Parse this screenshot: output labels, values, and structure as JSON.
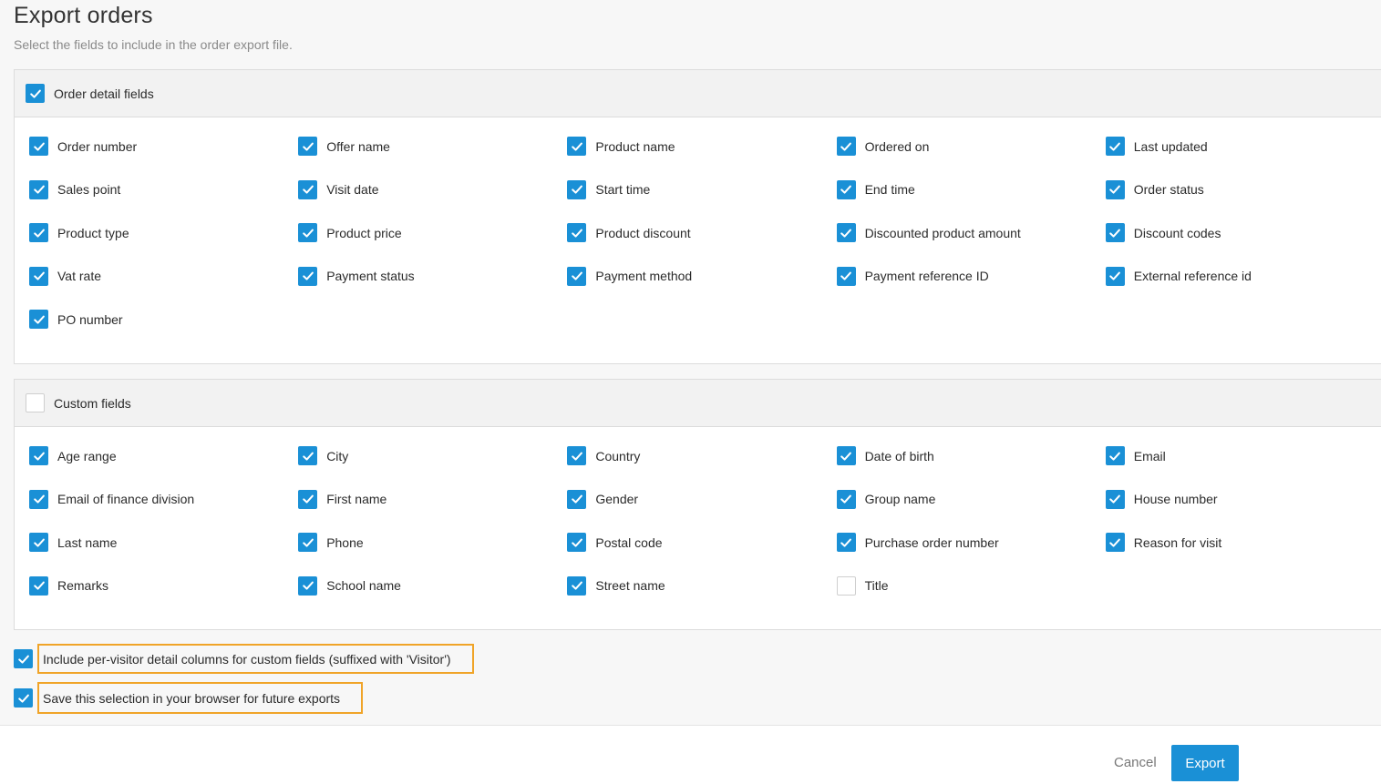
{
  "page": {
    "title": "Export orders",
    "subtitle": "Select the fields to include in the order export file."
  },
  "order_section": {
    "label": "Order detail fields",
    "checked": true,
    "fields": [
      {
        "label": "Order number",
        "checked": true
      },
      {
        "label": "Offer name",
        "checked": true
      },
      {
        "label": "Product name",
        "checked": true
      },
      {
        "label": "Ordered on",
        "checked": true
      },
      {
        "label": "Last updated",
        "checked": true
      },
      {
        "label": "Sales point",
        "checked": true
      },
      {
        "label": "Visit date",
        "checked": true
      },
      {
        "label": "Start time",
        "checked": true
      },
      {
        "label": "End time",
        "checked": true
      },
      {
        "label": "Order status",
        "checked": true
      },
      {
        "label": "Product type",
        "checked": true
      },
      {
        "label": "Product price",
        "checked": true
      },
      {
        "label": "Product discount",
        "checked": true
      },
      {
        "label": "Discounted product amount",
        "checked": true
      },
      {
        "label": "Discount codes",
        "checked": true
      },
      {
        "label": "Vat rate",
        "checked": true
      },
      {
        "label": "Payment status",
        "checked": true
      },
      {
        "label": "Payment method",
        "checked": true
      },
      {
        "label": "Payment reference ID",
        "checked": true
      },
      {
        "label": "External reference id",
        "checked": true
      },
      {
        "label": "PO number",
        "checked": true
      }
    ]
  },
  "custom_section": {
    "label": "Custom fields",
    "checked": false,
    "fields": [
      {
        "label": "Age range",
        "checked": true
      },
      {
        "label": "City",
        "checked": true
      },
      {
        "label": "Country",
        "checked": true
      },
      {
        "label": "Date of birth",
        "checked": true
      },
      {
        "label": "Email",
        "checked": true
      },
      {
        "label": "Email of finance division",
        "checked": true
      },
      {
        "label": "First name",
        "checked": true
      },
      {
        "label": "Gender",
        "checked": true
      },
      {
        "label": "Group name",
        "checked": true
      },
      {
        "label": "House number",
        "checked": true
      },
      {
        "label": "Last name",
        "checked": true
      },
      {
        "label": "Phone",
        "checked": true
      },
      {
        "label": "Postal code",
        "checked": true
      },
      {
        "label": "Purchase order number",
        "checked": true
      },
      {
        "label": "Reason for visit",
        "checked": true
      },
      {
        "label": "Remarks",
        "checked": true
      },
      {
        "label": "School name",
        "checked": true
      },
      {
        "label": "Street name",
        "checked": true
      },
      {
        "label": "Title",
        "checked": false
      }
    ]
  },
  "options": {
    "per_visitor": {
      "label": "Include per-visitor detail columns for custom fields (suffixed with 'Visitor')",
      "checked": true
    },
    "save_selection": {
      "label": "Save this selection in your browser for future exports",
      "checked": true
    }
  },
  "footer": {
    "cancel_label": "Cancel",
    "export_label": "Export"
  },
  "colors": {
    "accent": "#1a90d6",
    "highlight": "#f0a428"
  },
  "icons": {
    "checkbox_checked": "checkmark-icon",
    "checkbox_unchecked": "empty-checkbox"
  }
}
